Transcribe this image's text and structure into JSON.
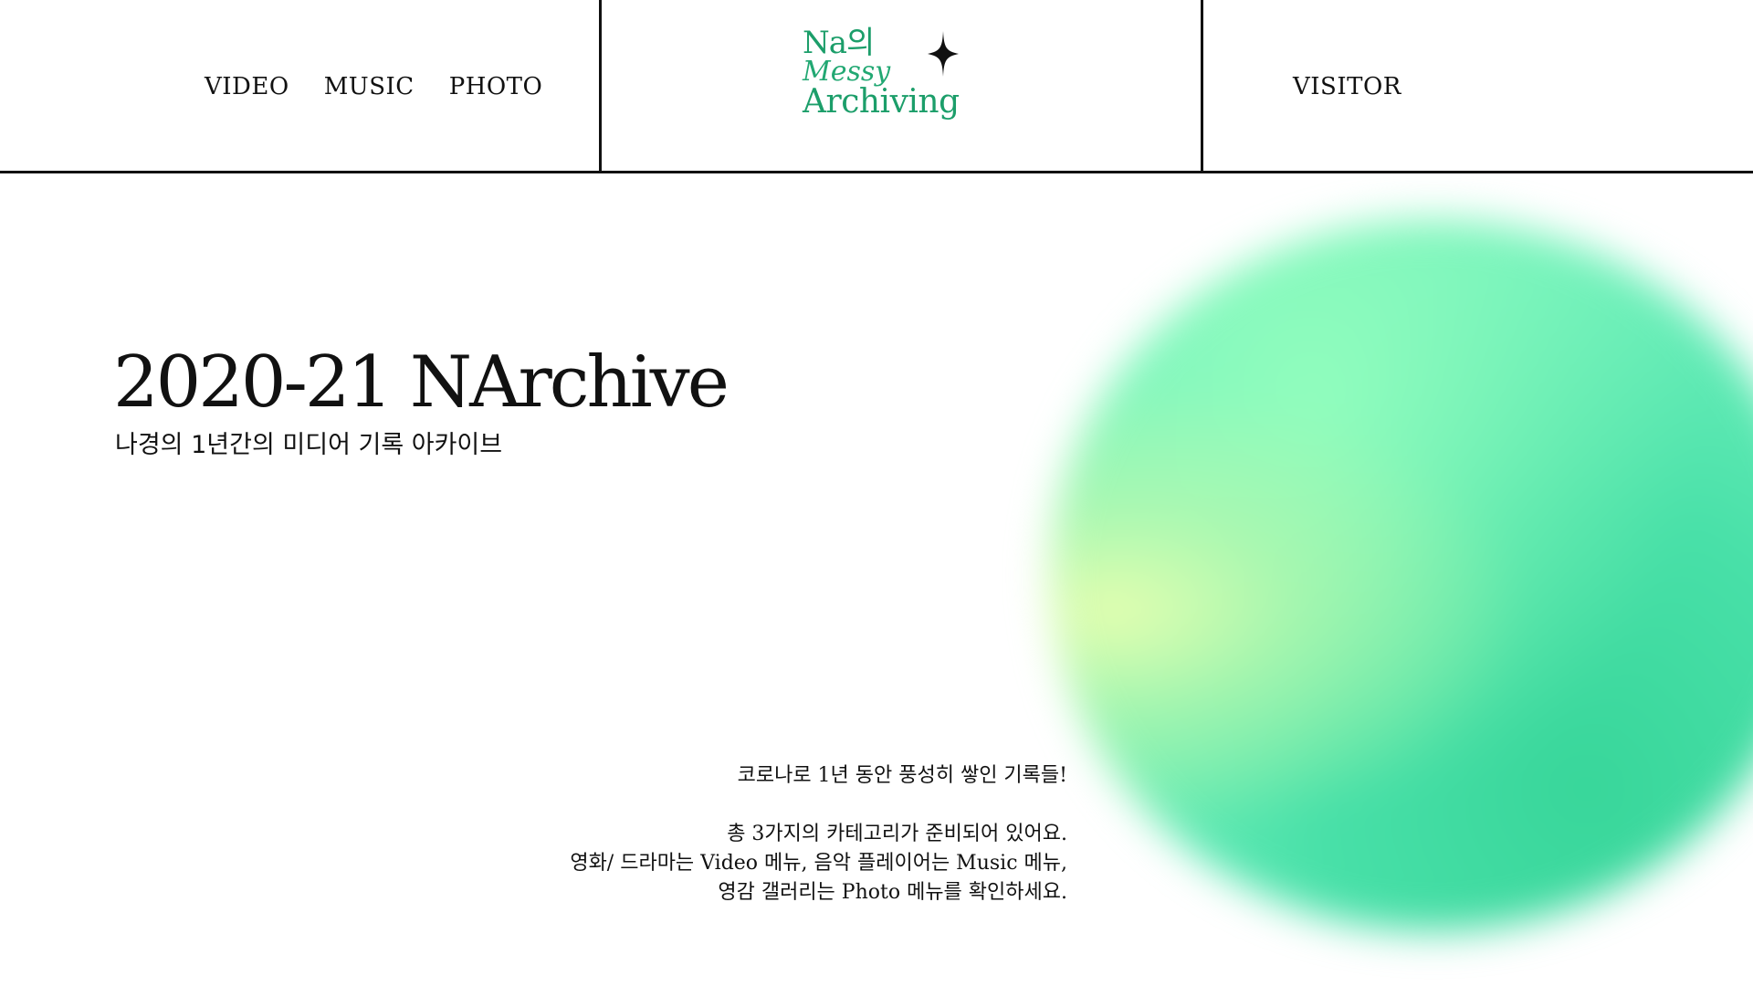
{
  "header": {
    "nav": [
      {
        "label": "VIDEO"
      },
      {
        "label": "MUSIC"
      },
      {
        "label": "PHOTO"
      }
    ],
    "logo": {
      "line1": "Na의",
      "line2": "Messy",
      "line3": "Archiving",
      "color": "#1c9e6a",
      "icon": "sparkle-star-icon"
    },
    "visitor_label": "VISITOR"
  },
  "hero": {
    "title": "2020-21 NArchive",
    "subtitle": "나경의 1년간의 미디어 기록 아카이브"
  },
  "description": {
    "line1": "코로나로 1년 동안 풍성히 쌓인 기록들!",
    "line2": "총 3가지의 카테고리가 준비되어 있어요.",
    "line3": "영화/ 드라마는 Video 메뉴, 음악 플레이어는 Music 메뉴,",
    "line4": "영감 갤러리는 Photo 메뉴를 확인하세요."
  },
  "colors": {
    "accent": "#1c9e6a",
    "orb_light": "#eaffaf",
    "orb_mid": "#80f3c5",
    "orb_dark": "#38d69a"
  }
}
